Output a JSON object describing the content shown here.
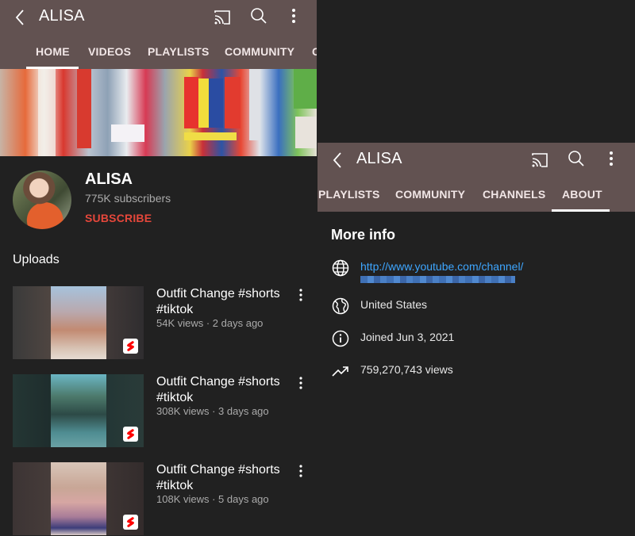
{
  "left_screen": {
    "appbar": {
      "title": "ALISA",
      "icons": [
        "back-arrow-icon",
        "cast-icon",
        "search-icon",
        "more-vert-icon"
      ]
    },
    "tabs": [
      {
        "label": "HOME",
        "active": true
      },
      {
        "label": "VIDEOS",
        "active": false
      },
      {
        "label": "PLAYLISTS",
        "active": false
      },
      {
        "label": "COMMUNITY",
        "active": false
      },
      {
        "label": "C",
        "active": false
      }
    ],
    "channel": {
      "name": "ALISA",
      "subscribers": "775K subscribers",
      "subscribe_label": "SUBSCRIBE"
    },
    "uploads_title": "Uploads",
    "videos": [
      {
        "title": "Outfit Change #shorts #tiktok",
        "meta": "54K views · 2 days ago",
        "badge": "shorts-icon"
      },
      {
        "title": "Outfit Change #shorts #tiktok",
        "meta": "308K views · 3 days ago",
        "badge": "shorts-icon"
      },
      {
        "title": "Outfit Change #shorts #tiktok",
        "meta": "108K views · 5 days ago",
        "badge": "shorts-icon"
      }
    ]
  },
  "right_screen": {
    "appbar": {
      "title": "ALISA",
      "icons": [
        "back-arrow-icon",
        "cast-icon",
        "search-icon",
        "more-vert-icon"
      ]
    },
    "tabs": [
      {
        "label": "PLAYLISTS",
        "active": false
      },
      {
        "label": "COMMUNITY",
        "active": false
      },
      {
        "label": "CHANNELS",
        "active": false
      },
      {
        "label": "ABOUT",
        "active": true
      }
    ],
    "more_info": {
      "title": "More info",
      "link": "http://www.youtube.com/channel/",
      "country": "United States",
      "joined": "Joined Jun 3, 2021",
      "views": "759,270,743 views"
    }
  },
  "colors": {
    "appbar_bg": "#625251",
    "page_bg": "#212121",
    "subscribe": "#e6473b",
    "link": "#3ea6ff",
    "secondary_text": "#aaaaaa"
  }
}
